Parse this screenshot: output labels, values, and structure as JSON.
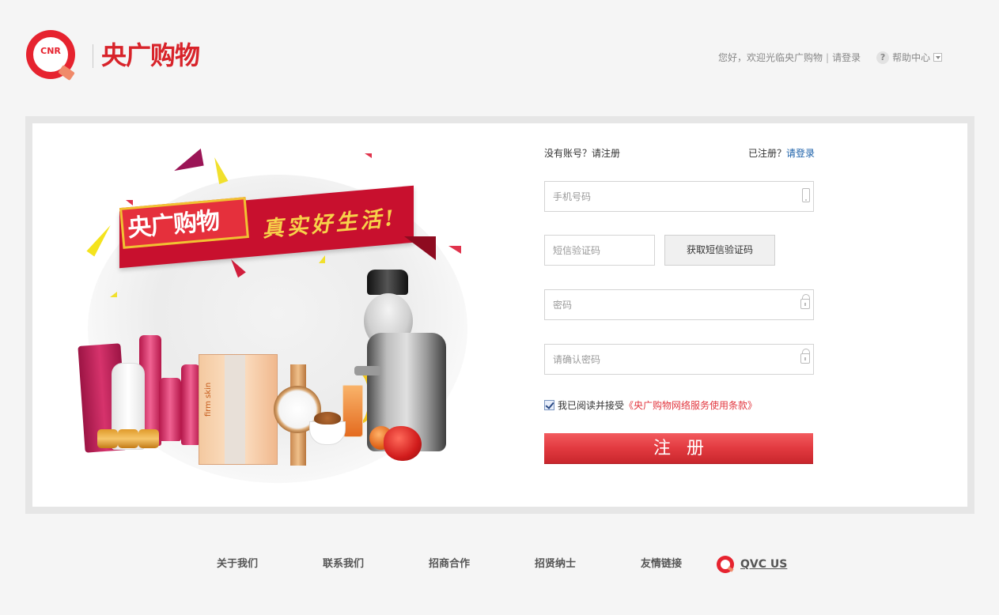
{
  "header": {
    "logo_mark": "CNR",
    "logo_text": "央广购物",
    "welcome": "您好，欢迎光临央广购物",
    "separator": "|",
    "login_link": "请登录",
    "help_center": "帮助中心",
    "help_icon_glyph": "?"
  },
  "promo": {
    "banner_logo": "央广购物",
    "banner_slogan": "真实好生活!",
    "box_label": "firm skin",
    "accent_color": "#c8102e"
  },
  "form": {
    "no_account": "没有账号？请注册",
    "registered_prefix": "已注册？",
    "login_link": "请登录",
    "phone_placeholder": "手机号码",
    "sms_placeholder": "短信验证码",
    "sms_button": "获取短信验证码",
    "password_placeholder": "密码",
    "confirm_placeholder": "请确认密码",
    "agree_prefix": "我已阅读并接受",
    "terms_link": "《央广购物网络服务使用条款》",
    "agree_checked": true,
    "register_button": "注册",
    "button_color": "#e23a40"
  },
  "footer": {
    "links": [
      "关于我们",
      "联系我们",
      "招商合作",
      "招贤纳士",
      "友情链接"
    ],
    "qvc": "QVC US"
  }
}
